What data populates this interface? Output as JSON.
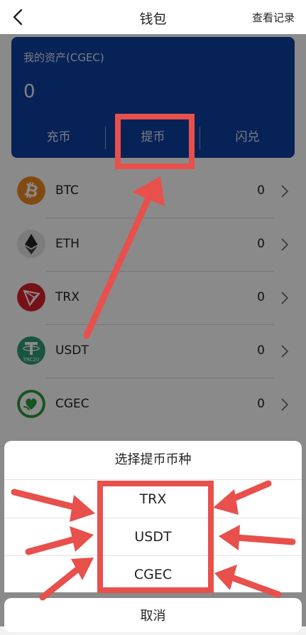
{
  "header": {
    "title": "钱包",
    "records_label": "查看记录"
  },
  "card": {
    "label": "我的资产(CGEC)",
    "amount": "0",
    "actions": [
      "充币",
      "提币",
      "闪兑"
    ]
  },
  "coins": [
    {
      "name": "BTC",
      "value": "0",
      "icon": "bitcoin-icon",
      "color": "#f08a24"
    },
    {
      "name": "ETH",
      "value": "0",
      "icon": "ethereum-icon",
      "color": "#e6e6e6"
    },
    {
      "name": "TRX",
      "value": "0",
      "icon": "tron-icon",
      "color": "#d9202b"
    },
    {
      "name": "USDT",
      "value": "0",
      "icon": "tether-icon",
      "color": "#2f9b78",
      "badge": "TRC20"
    },
    {
      "name": "CGEC",
      "value": "0",
      "icon": "cgec-icon",
      "color": "#2a9a3c"
    }
  ],
  "sheet": {
    "title": "选择提币币种",
    "options": [
      "TRX",
      "USDT",
      "CGEC"
    ],
    "cancel": "取消"
  },
  "colors": {
    "card_bg": "#0d3fa0",
    "annotation": "#e8504c"
  }
}
